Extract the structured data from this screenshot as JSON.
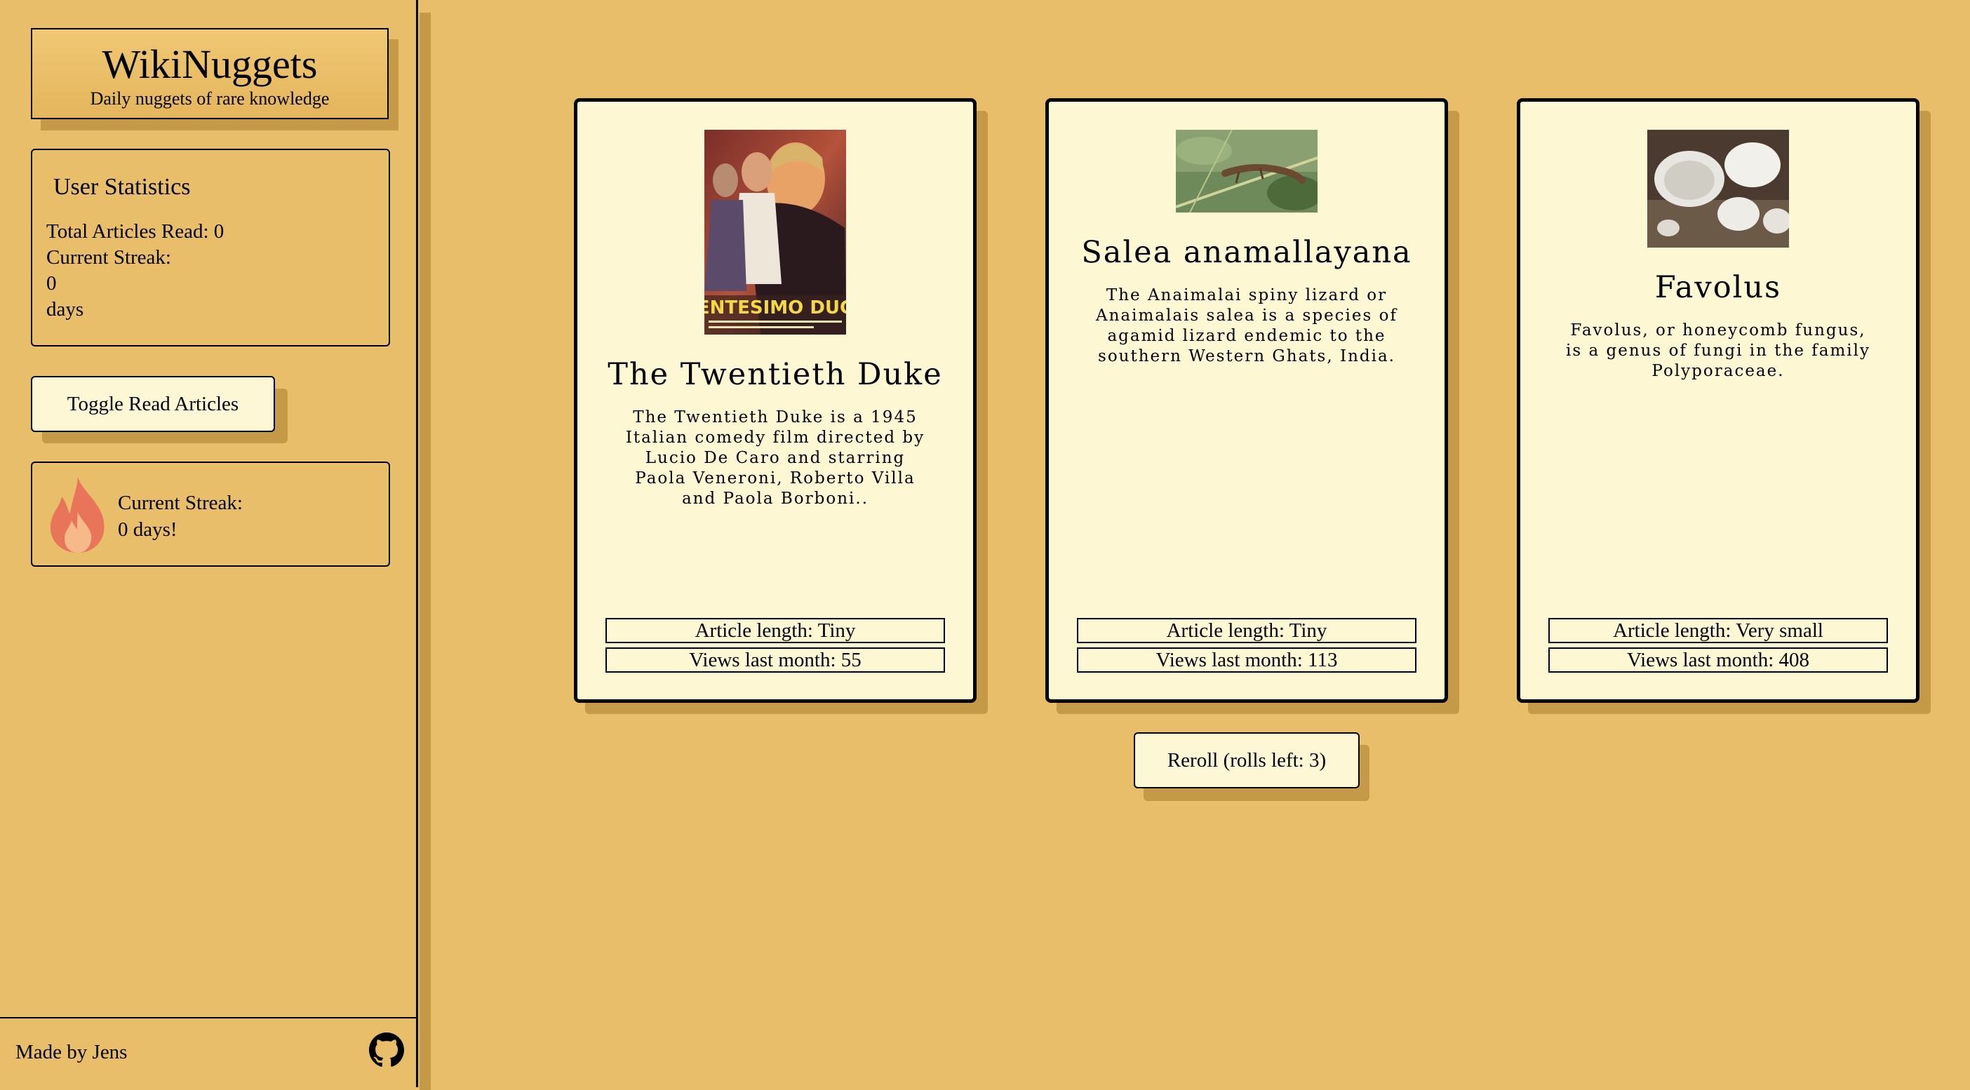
{
  "brand": {
    "title": "WikiNuggets",
    "subtitle": "Daily nuggets of rare knowledge"
  },
  "stats": {
    "heading": "User Statistics",
    "total_label": "Total Articles Read: 0",
    "streak_label": "Current Streak:",
    "streak_value": "0",
    "streak_unit": "days"
  },
  "toggle_button": "Toggle Read Articles",
  "streak_box": {
    "label": "Current Streak:",
    "value": "0 days!",
    "icon": "flame-icon",
    "icon_color": "#e8745a"
  },
  "footer": {
    "made_by": "Made by Jens",
    "icon": "github-icon"
  },
  "cards": [
    {
      "title": "The Twentieth Duke",
      "description": "The Twentieth Duke is a 1945 Italian comedy film directed by Lucio De Caro and starring Paola Veneroni, Roberto Villa and Paola Borboni..",
      "length": "Article length: Tiny",
      "views": "Views last month: 55",
      "image": "movie-poster-image",
      "poster_text": "VENTESIMO DUCA"
    },
    {
      "title": "Salea anamallayana",
      "description": "The Anaimalai spiny lizard or Anaimalais salea is a species of agamid lizard endemic to the southern Western Ghats, India.",
      "length": "Article length: Tiny",
      "views": "Views last month: 113",
      "image": "lizard-photo"
    },
    {
      "title": "Favolus",
      "description": "Favolus, or honeycomb fungus, is a genus of fungi in the family Polyporaceae.",
      "length": "Article length: Very small",
      "views": "Views last month: 408",
      "image": "fungus-photo"
    }
  ],
  "reroll_button": "Reroll (rolls left: 3)",
  "colors": {
    "background": "#e8be6a",
    "card": "#fef7d3",
    "shadow": "#c49a48",
    "border": "#000000"
  }
}
